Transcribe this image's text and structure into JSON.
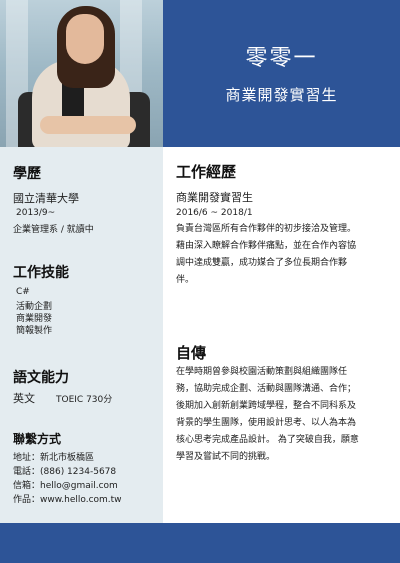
{
  "header": {
    "name": "零零一",
    "title": "商業開發實習生"
  },
  "sidebar": {
    "education": {
      "heading": "學歷",
      "school": "國立清華大學",
      "period": "2013/9~",
      "dept": "企業管理系 / 就讀中"
    },
    "skills": {
      "heading": "工作技能",
      "items": [
        "C#",
        "活動企劃",
        "商業開發",
        "簡報製作"
      ]
    },
    "language": {
      "heading": "語文能力",
      "lang": "英文",
      "score": "TOEIC  730分"
    },
    "contact": {
      "heading": "聯繫方式",
      "address": "地址：新北市板橋區",
      "phone": "電話：(886) 1234-5678",
      "email": "信箱：hello@gmail.com",
      "website": "作品：www.hello.com.tw"
    }
  },
  "experience": {
    "heading": "工作經歷",
    "role": "商業開發實習生",
    "period": "2016/6 ~ 2018/1",
    "lines": [
      "負責台灣區所有合作夥伴的初步接洽及管理。",
      "藉由深入瞭解合作夥伴痛點，並在合作內容協",
      "調中達成雙贏，成功媒合了多位長期合作夥",
      "伴。"
    ]
  },
  "about": {
    "heading": "自傳",
    "lines": [
      "在學時期曾參與校園活動策劃與組織團隊任",
      "務，協助完成企劃、活動與團隊溝通、合作；",
      "後期加入創新創業跨域學程，整合不同科系及",
      "背景的學生團隊，使用設計思考、以人為本為",
      "核心思考完成產品設計。 為了突破自我，願意",
      "學習及嘗試不同的挑戰。"
    ]
  },
  "colors": {
    "accent": "#2d5497",
    "sidebar_bg": "#e4ecf0"
  }
}
